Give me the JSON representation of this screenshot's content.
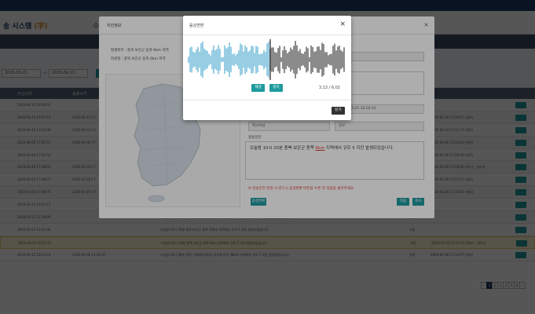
{
  "app": {
    "title": "송 시스템",
    "title_sub": "(字)",
    "header_tab": "수"
  },
  "filters": {
    "date_from": "2020-03-01",
    "date_to": "2020-04-13"
  },
  "table": {
    "headers": [
      "수신시각",
      "송출시각",
      "",
      "",
      "대"
    ],
    "rows": [
      {
        "c1": "2020-04-10 16:04:02",
        "c2": "",
        "c3": "",
        "c4": "",
        "c5": ""
      },
      {
        "c1": "2020-04-10 15:07:14",
        "c2": "2020-04-10 15:",
        "c3": "",
        "c4": "",
        "c5": "2020-04-10 15:09:07 (완료)"
      },
      {
        "c1": "2020-04-10 13:54:48",
        "c2": "2020-04-10 13:",
        "c3": "",
        "c4": "",
        "c5": "2020-04-10 13:11:27 (완료)"
      },
      {
        "c1": "2020-04-06 17:05:22",
        "c2": "2020-04-06 17:",
        "c3": "",
        "c4": "",
        "c5": "2020-04-06 16:54:41 (완료)"
      },
      {
        "c1": "2020-03-26 17:05:54",
        "c2": "",
        "c3": "",
        "c4": "",
        "c5": "2020-03-26 17:05:46 (완료)"
      },
      {
        "c1": "2020-03-26 17:48:02",
        "c2": "2020-03-26 17:",
        "c3": "",
        "c4": "",
        "c5": "2020-03-26 17:48:02 (취소) - 권리자"
      },
      {
        "c1": "2020-03-26 17:48:27",
        "c2": "2020-03-26 17:",
        "c3": "",
        "c4": "",
        "c5": "2020-03-26 17:23:25 (완료)"
      },
      {
        "c1": "2020-03-26 17:48:05",
        "c2": "2020-03-26 17:",
        "c3": "",
        "c4": "",
        "c5": "2020-03-26 17:28:51 (완료)"
      },
      {
        "c1": "2020-03-25 16:23:11",
        "c2": "",
        "c3": "",
        "c4": "",
        "c5": ""
      },
      {
        "c1": "2020-03-25 11:19:09",
        "c2": "",
        "c3": "오늘밤 10시 20분 테스트중북 청주시 흥덕구 서남서쪽 9km 지역에서 규모 5 지진 발생되었습니다.",
        "c4": "이용",
        "c5": ""
      },
      {
        "c1": "2020-03-25 11:31:46",
        "c2": "",
        "c3": "오늘밤 10시 20분 중북 보은군 동쪽 21km 지역에서 규모 5 지진 발생되었습니다.",
        "c4": "이용",
        "c5": ""
      },
      {
        "c1": "2020-03-25 10:21:51",
        "c2": "",
        "c3": "오늘밤 10시 20분 중북 보은군 동쪽 6km 지역에서 규모 5 지진 발생되었습니다.",
        "c4": "이용",
        "c5": "2020-03-25 11:22:27 (취소) - 권리자",
        "hl": true
      },
      {
        "c1": "2020-03-12 16:23:16",
        "c2": "2020-04-08 11:32:07",
        "c3": "오늘밤 10시 30분 경북 시마레츠(중급) 마곡에 동쪽 38km 지역에서 규모 5 지진 발생되었습니다.",
        "c4": "이용",
        "c5": "2020-04-08 11:32:07 (완료)"
      }
    ]
  },
  "pagination": [
    "‹",
    "1",
    "2",
    "3",
    "4",
    "5",
    "6",
    "›"
  ],
  "pagination_active": 1,
  "detail_modal": {
    "title": "지진정보",
    "close": "×",
    "location_line": "발생위치 : 충북 보은군 동쪽 6km 지역",
    "magnitude_line": "진원정 : 충북 보은군 동쪽 6km 지역",
    "fields": {
      "date_value": "2020-03-25 10:20:10",
      "station_label": "",
      "station_value": "백시아님",
      "extra_label": "방출 채널",
      "extra_value": "김우"
    },
    "content_label": "방송문안",
    "content_text_pre": "오늘밤 10시 20분 충북 보은군 동쪽 ",
    "content_text_hl": "6km",
    "content_text_post": " 지역에서 규모 5 지진 발생되었습니다.",
    "warning": "※ 방송문안 변경 시 반드시 음성변환 버튼을 누른 후 적용을 눌러주세요.",
    "convert_btn": "음성변환",
    "apply_btn": "적용",
    "cancel_btn": "취소"
  },
  "audio_modal": {
    "title": "음성변환",
    "close": "×",
    "play_btn": "재생",
    "stop_btn": "정지",
    "time": "3.13 / 6.02",
    "progress_fraction": 0.52,
    "close_btn": "닫기",
    "colors": {
      "played": "#7fc1dd",
      "remaining": "#6e6e6e"
    }
  }
}
